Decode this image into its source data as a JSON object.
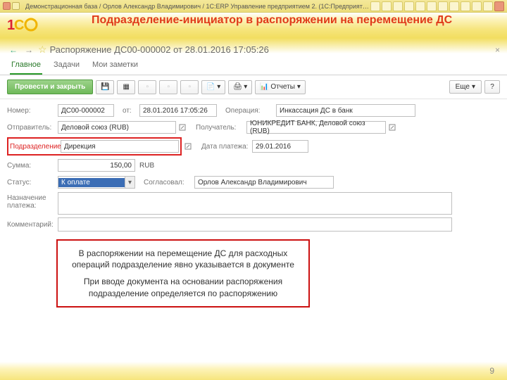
{
  "window": {
    "title": "Демонстрационная база / Орлов Александр Владимирович / 1С:ERP Управление предприятием 2. (1С:Предприятие)"
  },
  "slide": {
    "title": "Подразделение-инициатор в распоряжении на перемещение ДС",
    "page_number": "9"
  },
  "doc": {
    "title": "Распоряжение ДС00-000002 от 28.01.2016 17:05:26"
  },
  "tabs": {
    "main": "Главное",
    "tasks": "Задачи",
    "notes": "Мои заметки"
  },
  "toolbar": {
    "post_close": "Провести и закрыть",
    "reports": "Отчеты",
    "more": "Еще",
    "help": "?"
  },
  "form": {
    "labels": {
      "number": "Номер:",
      "from": "от:",
      "operation": "Операция:",
      "sender": "Отправитель:",
      "recipient": "Получатель:",
      "department": "Подразделение:",
      "pay_date": "Дата платежа:",
      "amount": "Сумма:",
      "currency": "RUB",
      "status": "Статус:",
      "approved": "Согласовал:",
      "purpose": "Назначение платежа:",
      "comment": "Комментарий:"
    },
    "values": {
      "number": "ДС00-000002",
      "from": "28.01.2016 17:05:26",
      "operation": "Инкассация ДС в банк",
      "sender": "Деловой союз (RUB)",
      "recipient": "ЮНИКРЕДИТ БАНК, Деловой союз (RUB)",
      "department": "Дирекция",
      "pay_date": "29.01.2016",
      "amount": "150,00",
      "status": "К оплате",
      "approved": "Орлов Александр Владимирович"
    }
  },
  "callout": {
    "p1": "В распоряжении на перемещение ДС для расходных операций подразделение явно указывается в документе",
    "p2": "При вводе документа на основании распоряжения подразделение определяется по распоряжению"
  }
}
